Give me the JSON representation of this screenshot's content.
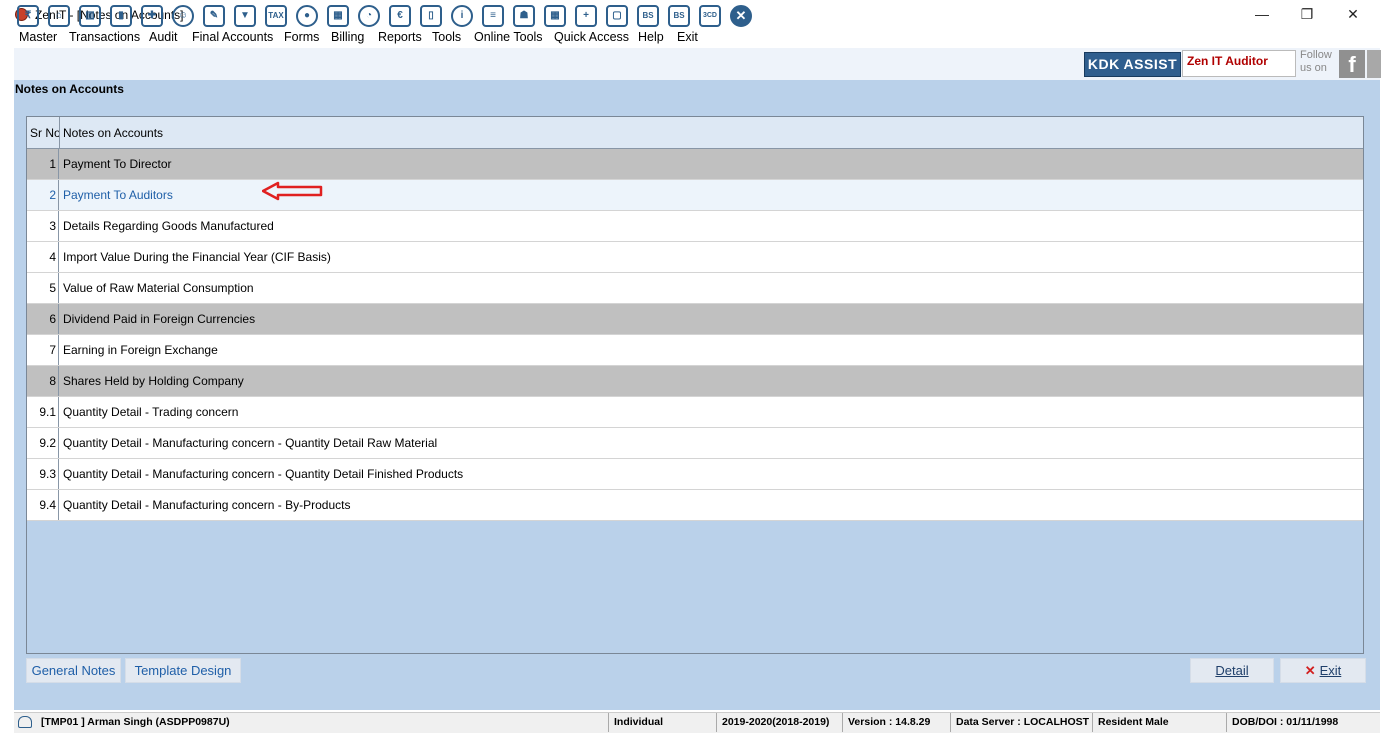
{
  "window": {
    "title": "ZenIT - [Notes on Accounts]",
    "minimize_glyph": "—",
    "restore_glyph": "❐",
    "close_glyph": "✕"
  },
  "menu": [
    "Master",
    "Transactions",
    "Audit",
    "Final Accounts",
    "Forms",
    "Billing",
    "Reports",
    "Tools",
    "Online Tools",
    "Quick Access",
    "Help",
    "Exit"
  ],
  "toolbar": {
    "icons": [
      "ledger-icon",
      "home-icon",
      "building-icon",
      "bar-chart-icon",
      "gift-icon",
      "users-icon",
      "pin-icon",
      "filter-icon",
      "tax-icon",
      "toggle-icon",
      "calculator-icon",
      "pie-icon",
      "pay-icon",
      "book-icon",
      "info-icon",
      "report-icon",
      "user-edit-icon",
      "calendar-icon",
      "folder-add-icon",
      "document-icon",
      "bs-icon",
      "bs-sch-icon",
      "3cd-icon",
      "close-circle-icon"
    ],
    "icon_text": {
      "tax-icon": "TAX",
      "pay-icon": "€",
      "bs-icon": "BS",
      "bs-sch-icon": "BS",
      "3cd-icon": "3CD",
      "info-icon": "i",
      "close-circle-icon": "✕"
    },
    "kdk_label": "KDK ASSIST",
    "zen_auditor_label": "Zen IT Auditor",
    "follow_line1": "Follow",
    "follow_line2": "us on",
    "facebook_glyph": "f"
  },
  "page": {
    "heading": "Notes on Accounts"
  },
  "grid": {
    "columns": [
      "Sr No",
      "Notes on Accounts"
    ],
    "rows": [
      {
        "sr": "1",
        "name": "Payment To Director",
        "style": "gray"
      },
      {
        "sr": "2",
        "name": "Payment To Auditors",
        "style": "sel"
      },
      {
        "sr": "3",
        "name": "Details Regarding Goods Manufactured",
        "style": "white"
      },
      {
        "sr": "4",
        "name": "Import Value During the Financial Year (CIF Basis)",
        "style": "white"
      },
      {
        "sr": "5",
        "name": "Value of Raw Material Consumption",
        "style": "white"
      },
      {
        "sr": "6",
        "name": "Dividend Paid in Foreign Currencies",
        "style": "gray"
      },
      {
        "sr": "7",
        "name": "Earning in Foreign Exchange",
        "style": "white"
      },
      {
        "sr": "8",
        "name": "Shares Held by Holding Company",
        "style": "gray"
      },
      {
        "sr": "9.1",
        "name": "Quantity Detail - Trading concern",
        "style": "white"
      },
      {
        "sr": "9.2",
        "name": "Quantity Detail - Manufacturing concern - Quantity Detail Raw Material",
        "style": "white"
      },
      {
        "sr": "9.3",
        "name": "Quantity Detail - Manufacturing concern - Quantity Detail Finished Products",
        "style": "white"
      },
      {
        "sr": "9.4",
        "name": "Quantity Detail - Manufacturing concern - By-Products",
        "style": "white"
      }
    ]
  },
  "buttons": {
    "general_notes": "General Notes",
    "template_design": "Template Design",
    "detail": "Detail",
    "exit": "Exit",
    "exit_glyph": "✕"
  },
  "status": {
    "user": "[TMP01 ] Arman Singh  (ASDPP0987U)",
    "type": "Individual",
    "year": "2019-2020(2018-2019)",
    "version": "Version : 14.8.29",
    "server": "Data Server : LOCALHOST",
    "residency": "Resident Male",
    "dob": "DOB/DOI : 01/11/1998"
  },
  "colors": {
    "accent": "#2f5e8e",
    "panel_bg": "#bad1ea",
    "selected_text": "#1f5fa8",
    "arrow": "#e02020"
  }
}
